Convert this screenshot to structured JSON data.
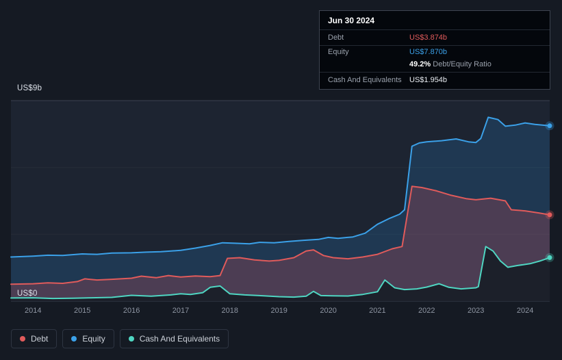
{
  "tooltip": {
    "date": "Jun 30 2024",
    "debt_label": "Debt",
    "debt_value": "US$3.874b",
    "equity_label": "Equity",
    "equity_value": "US$7.870b",
    "ratio_value": "49.2%",
    "ratio_label": "Debt/Equity Ratio",
    "cash_label": "Cash And Equivalents",
    "cash_value": "US$1.954b"
  },
  "chart": {
    "y_top_label": "US$9b",
    "y_bottom_label": "US$0"
  },
  "legend": {
    "items": [
      {
        "label": "Debt",
        "color": "#e15b5b"
      },
      {
        "label": "Equity",
        "color": "#3ba1e9"
      },
      {
        "label": "Cash And Equivalents",
        "color": "#4fd6c2"
      }
    ]
  },
  "chart_data": {
    "type": "area",
    "title": "",
    "xlabel": "",
    "ylabel": "",
    "y_unit": "US$ billions",
    "ylim": [
      0,
      9
    ],
    "x_range": [
      2013.55,
      2024.5
    ],
    "x_ticks": [
      2014,
      2015,
      2016,
      2017,
      2018,
      2019,
      2020,
      2021,
      2022,
      2023,
      2024
    ],
    "gridlines": [
      0,
      3,
      6,
      9
    ],
    "y_tick_labels": [
      "US$0",
      "US$9b"
    ],
    "legend_position": "bottom-left",
    "plot_bg": "#1d2431",
    "grid_color_major": "#3a4150",
    "grid_color_minor": "#262d39",
    "series": [
      {
        "name": "Equity",
        "color": "#3ba1e9",
        "fill": "rgba(41,138,215,0.20)",
        "points": [
          [
            2013.55,
            1.98
          ],
          [
            2014.0,
            2.02
          ],
          [
            2014.3,
            2.06
          ],
          [
            2014.6,
            2.05
          ],
          [
            2015.0,
            2.12
          ],
          [
            2015.3,
            2.1
          ],
          [
            2015.6,
            2.16
          ],
          [
            2016.0,
            2.17
          ],
          [
            2016.3,
            2.2
          ],
          [
            2016.6,
            2.22
          ],
          [
            2017.0,
            2.28
          ],
          [
            2017.3,
            2.38
          ],
          [
            2017.6,
            2.5
          ],
          [
            2017.85,
            2.62
          ],
          [
            2018.1,
            2.6
          ],
          [
            2018.4,
            2.57
          ],
          [
            2018.6,
            2.64
          ],
          [
            2018.9,
            2.62
          ],
          [
            2019.2,
            2.68
          ],
          [
            2019.5,
            2.73
          ],
          [
            2019.8,
            2.77
          ],
          [
            2020.0,
            2.86
          ],
          [
            2020.2,
            2.82
          ],
          [
            2020.5,
            2.88
          ],
          [
            2020.75,
            3.05
          ],
          [
            2021.0,
            3.45
          ],
          [
            2021.25,
            3.72
          ],
          [
            2021.45,
            3.9
          ],
          [
            2021.55,
            4.1
          ],
          [
            2021.7,
            6.95
          ],
          [
            2021.85,
            7.1
          ],
          [
            2022.0,
            7.15
          ],
          [
            2022.3,
            7.2
          ],
          [
            2022.6,
            7.28
          ],
          [
            2022.85,
            7.15
          ],
          [
            2023.0,
            7.12
          ],
          [
            2023.1,
            7.3
          ],
          [
            2023.25,
            8.25
          ],
          [
            2023.45,
            8.15
          ],
          [
            2023.6,
            7.85
          ],
          [
            2023.8,
            7.9
          ],
          [
            2024.0,
            8.0
          ],
          [
            2024.2,
            7.93
          ],
          [
            2024.5,
            7.87
          ]
        ]
      },
      {
        "name": "Debt",
        "color": "#e15b5b",
        "fill": "rgba(220,80,88,0.24)",
        "points": [
          [
            2013.55,
            0.76
          ],
          [
            2014.0,
            0.78
          ],
          [
            2014.3,
            0.82
          ],
          [
            2014.6,
            0.8
          ],
          [
            2014.9,
            0.88
          ],
          [
            2015.05,
            1.0
          ],
          [
            2015.3,
            0.95
          ],
          [
            2015.6,
            0.98
          ],
          [
            2016.0,
            1.03
          ],
          [
            2016.2,
            1.12
          ],
          [
            2016.5,
            1.05
          ],
          [
            2016.75,
            1.15
          ],
          [
            2017.0,
            1.08
          ],
          [
            2017.3,
            1.13
          ],
          [
            2017.6,
            1.1
          ],
          [
            2017.8,
            1.15
          ],
          [
            2017.95,
            1.92
          ],
          [
            2018.2,
            1.95
          ],
          [
            2018.5,
            1.85
          ],
          [
            2018.8,
            1.8
          ],
          [
            2019.0,
            1.83
          ],
          [
            2019.3,
            1.95
          ],
          [
            2019.55,
            2.25
          ],
          [
            2019.7,
            2.3
          ],
          [
            2019.9,
            2.05
          ],
          [
            2020.1,
            1.95
          ],
          [
            2020.4,
            1.9
          ],
          [
            2020.7,
            1.98
          ],
          [
            2021.0,
            2.1
          ],
          [
            2021.3,
            2.35
          ],
          [
            2021.5,
            2.45
          ],
          [
            2021.7,
            5.15
          ],
          [
            2021.9,
            5.1
          ],
          [
            2022.2,
            4.95
          ],
          [
            2022.5,
            4.75
          ],
          [
            2022.8,
            4.6
          ],
          [
            2023.0,
            4.55
          ],
          [
            2023.3,
            4.62
          ],
          [
            2023.6,
            4.5
          ],
          [
            2023.72,
            4.1
          ],
          [
            2024.0,
            4.05
          ],
          [
            2024.3,
            3.95
          ],
          [
            2024.5,
            3.874
          ]
        ]
      },
      {
        "name": "Cash And Equivalents",
        "color": "#4fd6c2",
        "fill": "rgba(20,27,35,0.85)",
        "points": [
          [
            2013.55,
            0.14
          ],
          [
            2014.0,
            0.15
          ],
          [
            2014.4,
            0.12
          ],
          [
            2014.8,
            0.13
          ],
          [
            2015.2,
            0.15
          ],
          [
            2015.6,
            0.17
          ],
          [
            2016.0,
            0.26
          ],
          [
            2016.4,
            0.22
          ],
          [
            2016.8,
            0.28
          ],
          [
            2017.0,
            0.33
          ],
          [
            2017.2,
            0.3
          ],
          [
            2017.45,
            0.38
          ],
          [
            2017.6,
            0.62
          ],
          [
            2017.8,
            0.68
          ],
          [
            2018.0,
            0.33
          ],
          [
            2018.3,
            0.28
          ],
          [
            2018.6,
            0.25
          ],
          [
            2019.0,
            0.2
          ],
          [
            2019.3,
            0.18
          ],
          [
            2019.55,
            0.22
          ],
          [
            2019.7,
            0.44
          ],
          [
            2019.85,
            0.25
          ],
          [
            2020.1,
            0.24
          ],
          [
            2020.4,
            0.23
          ],
          [
            2020.7,
            0.3
          ],
          [
            2021.0,
            0.42
          ],
          [
            2021.15,
            0.95
          ],
          [
            2021.35,
            0.6
          ],
          [
            2021.55,
            0.52
          ],
          [
            2021.8,
            0.55
          ],
          [
            2022.0,
            0.63
          ],
          [
            2022.25,
            0.78
          ],
          [
            2022.45,
            0.62
          ],
          [
            2022.7,
            0.55
          ],
          [
            2023.0,
            0.6
          ],
          [
            2023.05,
            0.65
          ],
          [
            2023.2,
            2.45
          ],
          [
            2023.35,
            2.25
          ],
          [
            2023.5,
            1.8
          ],
          [
            2023.65,
            1.52
          ],
          [
            2023.85,
            1.6
          ],
          [
            2024.1,
            1.68
          ],
          [
            2024.3,
            1.8
          ],
          [
            2024.5,
            1.954
          ]
        ]
      }
    ]
  }
}
